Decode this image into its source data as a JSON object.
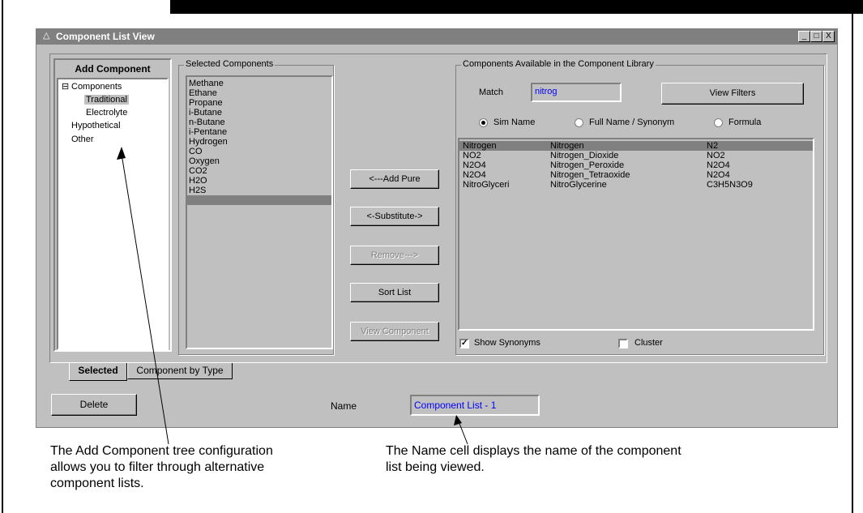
{
  "window": {
    "title": "Component List View",
    "controls": [
      "_",
      "□",
      "X"
    ]
  },
  "add_component": {
    "header": "Add Component",
    "tree": [
      {
        "label": "Components",
        "expander": "⊟"
      },
      {
        "label": "Traditional"
      },
      {
        "label": "Electrolyte"
      },
      {
        "label": "Hypothetical"
      },
      {
        "label": "Other"
      }
    ]
  },
  "selected_components": {
    "legend": "Selected Components",
    "items": [
      "Methane",
      "Ethane",
      "Propane",
      "i-Butane",
      "n-Butane",
      "i-Pentane",
      "Hydrogen",
      "CO",
      "Oxygen",
      "CO2",
      "H2O",
      "H2S"
    ]
  },
  "actions": {
    "add_pure": "<---Add Pure",
    "substitute": "<-Substitute->",
    "remove": "Remove--->",
    "sort_list": "Sort List",
    "view_component": "View Component"
  },
  "library": {
    "legend": "Components Available in the Component Library",
    "match_label": "Match",
    "match_value": "nitrog",
    "view_filters": "View Filters",
    "radios": [
      {
        "label": "Sim Name",
        "selected": true
      },
      {
        "label": "Full Name / Synonym",
        "selected": false
      },
      {
        "label": "Formula",
        "selected": false
      }
    ],
    "rows": [
      {
        "sim": "Nitrogen",
        "full": "Nitrogen",
        "formula": "N2",
        "selected": true
      },
      {
        "sim": "NO2",
        "full": "Nitrogen_Dioxide",
        "formula": "NO2",
        "selected": false
      },
      {
        "sim": "N2O4",
        "full": "Nitrogen_Peroxide",
        "formula": "N2O4",
        "selected": false
      },
      {
        "sim": "N2O4",
        "full": "Nitrogen_Tetraoxide",
        "formula": "N2O4",
        "selected": false
      },
      {
        "sim": "NitroGlyceri",
        "full": "NitroGlycerine",
        "formula": "C3H5N3O9",
        "selected": false
      }
    ],
    "show_synonyms": {
      "label": "Show Synonyms",
      "checked": true
    },
    "cluster": {
      "label": "Cluster",
      "checked": false
    }
  },
  "tabs": [
    "Selected",
    "Component by Type"
  ],
  "footer": {
    "delete": "Delete",
    "name_label": "Name",
    "name_value": "Component List - 1"
  },
  "captions": {
    "left": "The Add Component tree configuration allows you to filter through alternative component lists.",
    "right": "The Name cell displays the name of the component list being viewed."
  },
  "colors": {
    "accent_text": "#0000ff",
    "window_bg": "#c0c0c0",
    "selection": "#808080",
    "titlebar": "#808080"
  }
}
